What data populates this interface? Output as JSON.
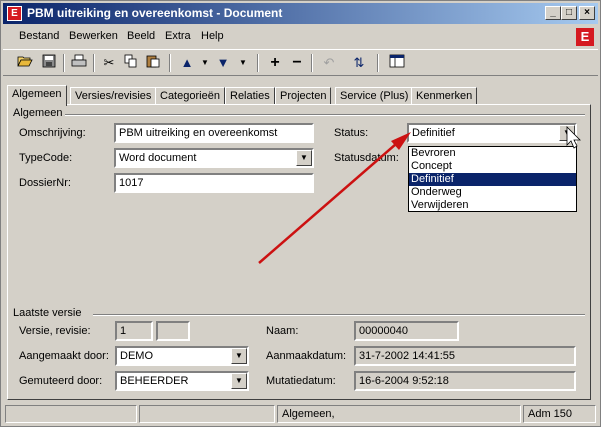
{
  "window": {
    "title": "PBM uitreiking en overeenkomst - Document",
    "app_icon": "E",
    "controls": [
      "_",
      "□",
      "×"
    ]
  },
  "menu": [
    "Bestand",
    "Bewerken",
    "Beeld",
    "Extra",
    "Help"
  ],
  "brand_logo": "E",
  "toolbar": {
    "icons": [
      "open-folder-icon",
      "save-icon",
      "print-icon",
      "cut-icon",
      "copy-icon",
      "paste-icon",
      "arrow-up-icon",
      "dropdown-icon",
      "arrow-down-icon",
      "dropdown-icon",
      "plus-icon",
      "minus-icon",
      "undo-icon",
      "refresh-icon",
      "window-icon"
    ]
  },
  "tabs": [
    "Algemeen",
    "Versies/revisies",
    "Categorieën",
    "Relaties",
    "Projecten",
    "Service (Plus)",
    "Kenmerken"
  ],
  "general": {
    "group_title": "Algemeen",
    "omschrijving_label": "Omschrijving:",
    "omschrijving_value": "PBM uitreiking en overeenkomst",
    "typecode_label": "TypeCode:",
    "typecode_value": "Word document",
    "dossiernr_label": "DossierNr:",
    "dossiernr_value": "1017",
    "status_label": "Status:",
    "status_value": "Definitief",
    "statusdatum_label": "Statusdatum:",
    "status_options": [
      "Bevroren",
      "Concept",
      "Definitief",
      "Onderweg",
      "Verwijderen"
    ],
    "status_selected_index": 2
  },
  "last_version": {
    "group_title": "Laatste versie",
    "versie_label": "Versie,  revisie:",
    "versie_value": "1",
    "revisie_value": "",
    "naam_label": "Naam:",
    "naam_value": "00000040",
    "aangemaakt_label": "Aangemaakt door:",
    "aangemaakt_value": "DEMO",
    "aanmaakdatum_label": "Aanmaakdatum:",
    "aanmaakdatum_value": "31-7-2002 14:41:55",
    "gemuteerd_label": "Gemuteerd door:",
    "gemuteerd_value": "BEHEERDER",
    "mutatiedatum_label": "Mutatiedatum:",
    "mutatiedatum_value": "16-6-2004 9:52:18"
  },
  "statusbar": {
    "cell1": "",
    "cell2": "",
    "cell3": "Algemeen,",
    "cell4": "Adm 150"
  },
  "colors": {
    "title_start": "#0a246a",
    "title_end": "#a6caf0",
    "brand_red": "#d51920",
    "arrow_red": "#cc1111",
    "face": "#d4d0c8"
  }
}
